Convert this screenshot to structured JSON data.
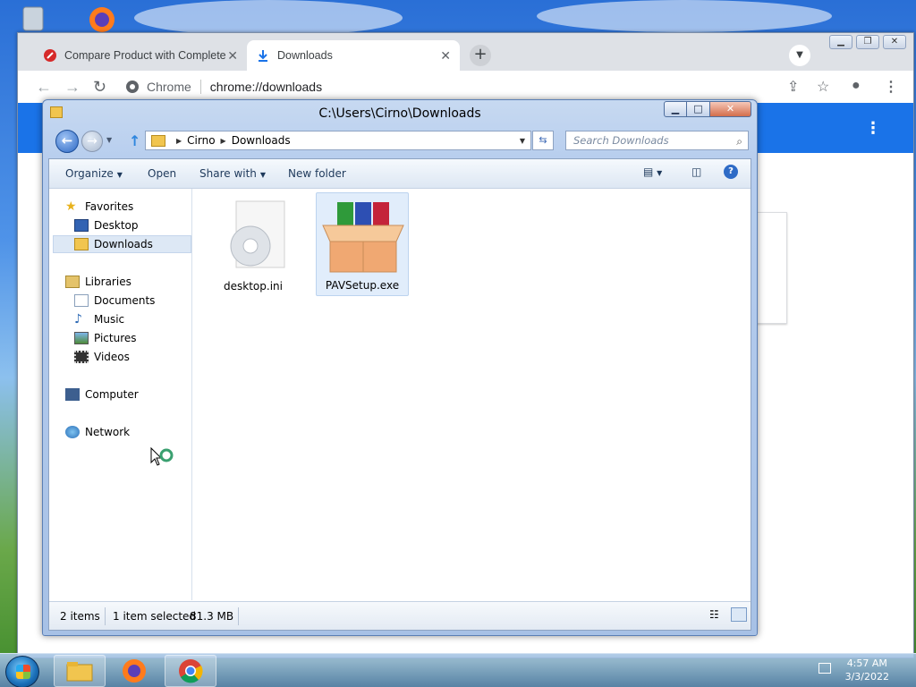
{
  "chrome": {
    "tabs": [
      {
        "label": "Compare Product with Complete",
        "icon": "brand-red-circle-icon",
        "active": false
      },
      {
        "label": "Downloads",
        "icon": "download-icon",
        "active": true
      }
    ],
    "omnibox_origin": "Chrome",
    "omnibox_url": "chrome://downloads"
  },
  "explorer": {
    "title": "C:\\Users\\Cirno\\Downloads",
    "breadcrumb": [
      "Cirno",
      "Downloads"
    ],
    "search_placeholder": "Search Downloads",
    "commands": {
      "organize": "Organize",
      "open": "Open",
      "share_with": "Share with",
      "new_folder": "New folder"
    },
    "nav": {
      "favorites": "Favorites",
      "desktop": "Desktop",
      "downloads": "Downloads",
      "libraries": "Libraries",
      "documents": "Documents",
      "music": "Music",
      "pictures": "Pictures",
      "videos": "Videos",
      "computer": "Computer",
      "network": "Network"
    },
    "files": [
      {
        "name": "desktop.ini",
        "icon": "settings-file-icon",
        "selected": false
      },
      {
        "name": "PAVSetup.exe",
        "icon": "installer-box-icon",
        "selected": true
      }
    ],
    "status": {
      "items": "2 items",
      "selected": "1 item selected",
      "size": "81.3 MB"
    }
  },
  "taskbar": {
    "time": "4:57 AM",
    "date": "3/3/2022"
  },
  "colors": {
    "chrome_blue": "#1a73e8",
    "explorer_frame": "#b6cdee"
  }
}
